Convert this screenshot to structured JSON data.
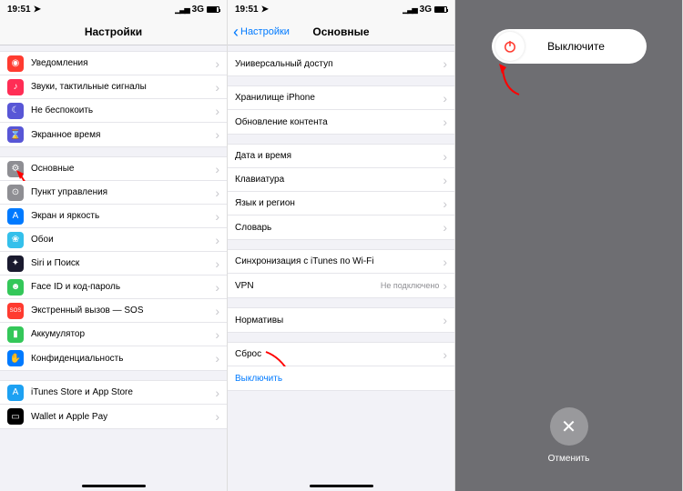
{
  "status": {
    "time": "19:51",
    "network": "3G"
  },
  "panel1": {
    "title": "Настройки",
    "g1": [
      {
        "icon": "#ff3b30",
        "glyph": "◉",
        "label": "Уведомления"
      },
      {
        "icon": "#ff2d55",
        "glyph": "♪",
        "label": "Звуки, тактильные сигналы"
      },
      {
        "icon": "#5856d6",
        "glyph": "☾",
        "label": "Не беспокоить"
      },
      {
        "icon": "#5856d6",
        "glyph": "⌛",
        "label": "Экранное время"
      }
    ],
    "g2": [
      {
        "icon": "#8e8e93",
        "glyph": "⚙",
        "label": "Основные"
      },
      {
        "icon": "#8e8e93",
        "glyph": "⊙",
        "label": "Пункт управления"
      },
      {
        "icon": "#007aff",
        "glyph": "A",
        "label": "Экран и яркость"
      },
      {
        "icon": "#34c0eb",
        "glyph": "❀",
        "label": "Обои"
      },
      {
        "icon": "#1a1a2e",
        "glyph": "✦",
        "label": "Siri и Поиск"
      },
      {
        "icon": "#34c759",
        "glyph": "☻",
        "label": "Face ID и код-пароль"
      },
      {
        "icon": "#ff3b30",
        "glyph": "SOS",
        "label": "Экстренный вызов — SOS"
      },
      {
        "icon": "#34c759",
        "glyph": "▮",
        "label": "Аккумулятор"
      },
      {
        "icon": "#007aff",
        "glyph": "✋",
        "label": "Конфиденциальность"
      }
    ],
    "g3": [
      {
        "icon": "#1da1f2",
        "glyph": "A",
        "label": "iTunes Store и App Store"
      },
      {
        "icon": "#000",
        "glyph": "▭",
        "label": "Wallet и Apple Pay"
      }
    ]
  },
  "panel2": {
    "back": "Настройки",
    "title": "Основные",
    "g1": [
      {
        "label": "Универсальный доступ"
      }
    ],
    "g2": [
      {
        "label": "Хранилище iPhone"
      },
      {
        "label": "Обновление контента"
      }
    ],
    "g3": [
      {
        "label": "Дата и время"
      },
      {
        "label": "Клавиатура"
      },
      {
        "label": "Язык и регион"
      },
      {
        "label": "Словарь"
      }
    ],
    "g4": [
      {
        "label": "Синхронизация с iTunes по Wi-Fi"
      },
      {
        "label": "VPN",
        "detail": "Не подключено"
      }
    ],
    "g5": [
      {
        "label": "Нормативы"
      }
    ],
    "g6": [
      {
        "label": "Сброс"
      },
      {
        "label": "Выключить",
        "link": true
      }
    ]
  },
  "panel3": {
    "slide": "Выключите",
    "cancel": "Отменить"
  }
}
